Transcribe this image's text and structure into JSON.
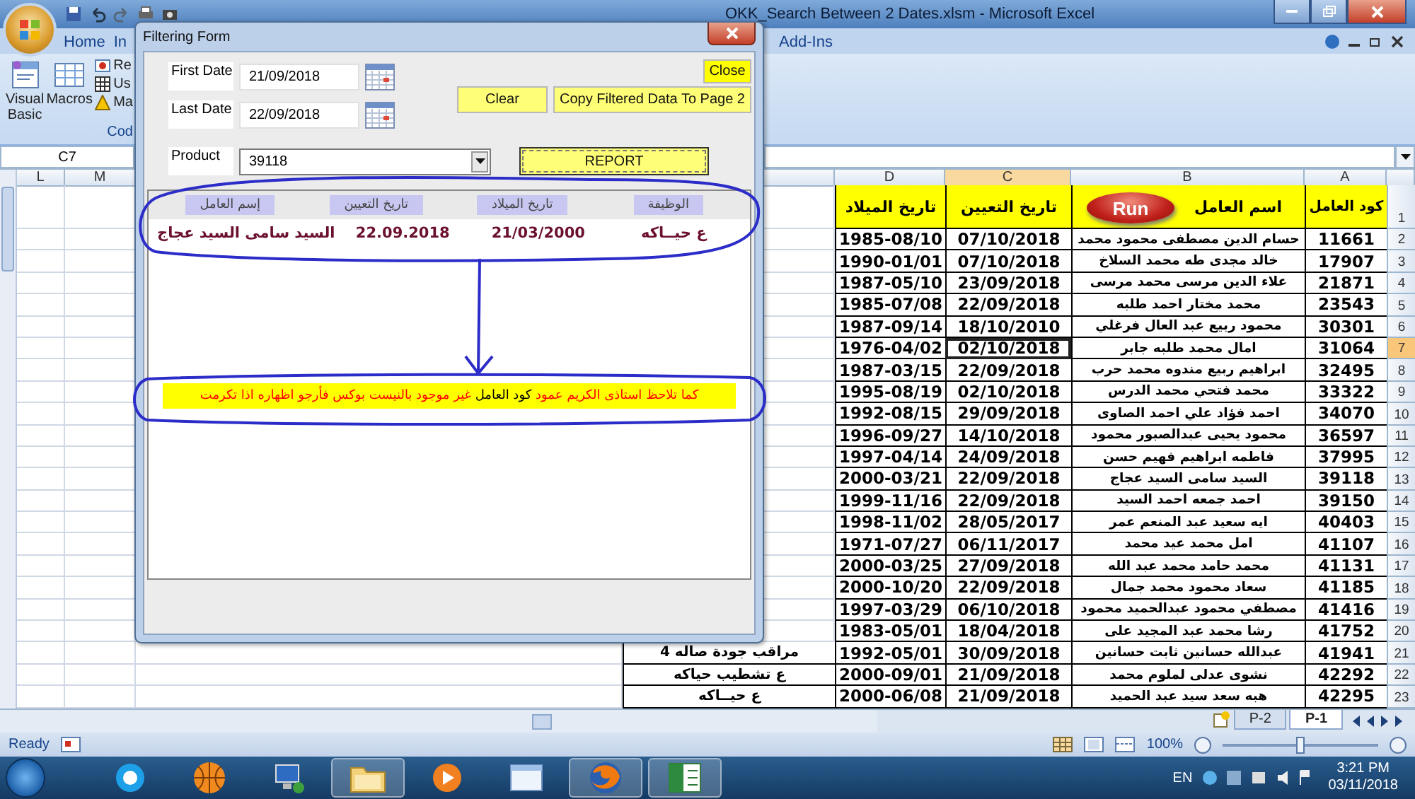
{
  "excel": {
    "title": "OKK_Search Between 2 Dates.xlsm - Microsoft Excel",
    "tabs": [
      {
        "label": "Home"
      },
      {
        "label": "In"
      },
      {
        "label": "Add-Ins"
      }
    ],
    "ribbon": {
      "large_buttons": [
        {
          "label": "Visual Basic",
          "kind": "vb"
        },
        {
          "label": "Macros",
          "kind": "macros"
        }
      ],
      "small_buttons": [
        {
          "label": "Re",
          "kind": "record"
        },
        {
          "label": "Us",
          "kind": "grid"
        },
        {
          "label": "Ma",
          "kind": "warning"
        }
      ],
      "group_label": "Cod"
    },
    "name_box": "C7"
  },
  "sheet": {
    "left_headers": [
      "L",
      "M"
    ],
    "right_headers": [
      {
        "label": "D",
        "selected": false
      },
      {
        "label": "C",
        "selected": true
      },
      {
        "label": "B",
        "selected": false
      },
      {
        "label": "A",
        "selected": false
      }
    ],
    "header_row": {
      "number": "1",
      "cells": [
        "كود العامل",
        "اسم العامل",
        "تاريخ التعيين",
        "تاريخ الميلاد"
      ]
    },
    "run_button": "Run",
    "rows": [
      {
        "number": "2",
        "code": "11661",
        "name": "حسام الدين مصطفى محمود محمد",
        "hire": "07/10/2018",
        "birth": "1985-08/10",
        "selected": false
      },
      {
        "number": "3",
        "code": "17907",
        "name": "خالد مجدى طه محمد السلاخ",
        "hire": "07/10/2018",
        "birth": "1990-01/01",
        "selected": false
      },
      {
        "number": "4",
        "code": "21871",
        "name": "علاء الدين مرسى محمد مرسى",
        "hire": "23/09/2018",
        "birth": "1987-05/10",
        "selected": false
      },
      {
        "number": "5",
        "code": "23543",
        "name": "محمد مختار احمد طلبه",
        "hire": "22/09/2018",
        "birth": "1985-07/08",
        "selected": false
      },
      {
        "number": "6",
        "code": "30301",
        "name": "محمود ربيع عبد العال فرغلي",
        "hire": "18/10/2010",
        "birth": "1987-09/14",
        "selected": false
      },
      {
        "number": "7",
        "code": "31064",
        "name": "امال محمد طلبه جابر",
        "hire": "02/10/2018",
        "birth": "1976-04/02",
        "selected": true
      },
      {
        "number": "8",
        "code": "32495",
        "name": "ابراهيم ربيع مندوه محمد حرب",
        "hire": "22/09/2018",
        "birth": "1987-03/15",
        "selected": false
      },
      {
        "number": "9",
        "code": "33322",
        "name": "محمد فتحي محمد الدرس",
        "hire": "02/10/2018",
        "birth": "1995-08/19",
        "selected": false
      },
      {
        "number": "10",
        "code": "34070",
        "name": "احمد فؤاد علي احمد الصاوى",
        "hire": "29/09/2018",
        "birth": "1992-08/15",
        "selected": false
      },
      {
        "number": "11",
        "code": "36597",
        "name": "محمود يحيى عبدالصبور محمود",
        "hire": "14/10/2018",
        "birth": "1996-09/27",
        "selected": false
      },
      {
        "number": "12",
        "code": "37995",
        "name": "فاطمه ابراهيم فهيم حسن",
        "hire": "24/09/2018",
        "birth": "1997-04/14",
        "selected": false
      },
      {
        "number": "13",
        "code": "39118",
        "name": "السيد سامى السيد عجاج",
        "hire": "22/09/2018",
        "birth": "2000-03/21",
        "selected": false
      },
      {
        "number": "14",
        "code": "39150",
        "name": "احمد جمعه احمد السيد",
        "hire": "22/09/2018",
        "birth": "1999-11/16",
        "selected": false
      },
      {
        "number": "15",
        "code": "40403",
        "name": "ايه سعيد عبد المنعم عمر",
        "hire": "28/05/2017",
        "birth": "1998-11/02",
        "selected": false
      },
      {
        "number": "16",
        "code": "41107",
        "name": "امل محمد عيد محمد",
        "hire": "06/11/2017",
        "birth": "1971-07/27",
        "selected": false
      },
      {
        "number": "17",
        "code": "41131",
        "name": "محمد حامد محمد عبد الله",
        "hire": "27/09/2018",
        "birth": "2000-03/25",
        "selected": false
      },
      {
        "number": "18",
        "code": "41185",
        "name": "سعاد محمود محمد جمال",
        "hire": "22/09/2018",
        "birth": "2000-10/20",
        "selected": false
      },
      {
        "number": "19",
        "code": "41416",
        "name": "مصطفي محمود عبدالحميد محمود",
        "hire": "06/10/2018",
        "birth": "1997-03/29",
        "selected": false
      },
      {
        "number": "20",
        "code": "41752",
        "name": "رشا محمد عبد المجيد على",
        "hire": "18/04/2018",
        "birth": "1983-05/01",
        "selected": false
      },
      {
        "number": "21",
        "code": "41941",
        "name": "عبدالله حسانين ثابت حسانين",
        "hire": "30/09/2018",
        "birth": "1992-05/01",
        "job": "مراقب جودة صاله 4",
        "selected": false
      },
      {
        "number": "22",
        "code": "42292",
        "name": "نشوى عدلى لملوم محمد",
        "hire": "21/09/2018",
        "birth": "2000-09/01",
        "job": "ع تشطيب حياكه",
        "selected": false
      },
      {
        "number": "23",
        "code": "42295",
        "name": "هبه سعد سيد عبد الحميد",
        "hire": "21/09/2018",
        "birth": "2000-06/08",
        "job": "ع حيــاكه",
        "selected": false
      }
    ],
    "sheet_tabs": [
      {
        "label": "P-2",
        "selected": false
      },
      {
        "label": "P-1",
        "selected": true
      }
    ]
  },
  "status_bar": {
    "text": "Ready",
    "zoom": "100%",
    "zoom_slider": {
      "level": 0.5
    }
  },
  "taskbar": {
    "apps": [
      {
        "kind": "chat",
        "active": false
      },
      {
        "kind": "ball",
        "active": false
      },
      {
        "kind": "network",
        "active": false
      },
      {
        "kind": "folder",
        "active": true
      },
      {
        "kind": "media",
        "active": false
      },
      {
        "kind": "window",
        "active": false
      },
      {
        "kind": "browser",
        "active": true
      },
      {
        "kind": "spreadsheet",
        "active": true
      }
    ],
    "language": "EN",
    "time": "3:21 PM",
    "date": "03/11/2018"
  },
  "dialog": {
    "title": "Filtering Form",
    "first_date": {
      "label": "First Date",
      "value": "21/09/2018"
    },
    "last_date": {
      "label": "Last Date",
      "value": "22/09/2018"
    },
    "product": {
      "label": "Product",
      "value": "39118"
    },
    "buttons": {
      "close": "Close",
      "clear": "Clear",
      "copy": "Copy Filtered Data To Page 2",
      "report": "REPORT"
    },
    "list": {
      "columns": [
        "إسم العامل",
        "تاريخ التعيين",
        "تاريخ الميلاد",
        "الوظيفة"
      ],
      "rows": [
        [
          "السيد سامى السيد عجاج",
          "22.09.2018",
          "21/03/2000",
          "ع حيــاكه"
        ]
      ]
    },
    "note": {
      "segments": [
        {
          "text": "كما تلاحظ استاذى الكريم عمود ",
          "emphasis": false
        },
        {
          "text": "كود العامل",
          "emphasis": true
        },
        {
          "text": " غير موجود بالنيست بوكس فأرجو اظهاره اذا تكرمت",
          "emphasis": false
        }
      ]
    }
  }
}
